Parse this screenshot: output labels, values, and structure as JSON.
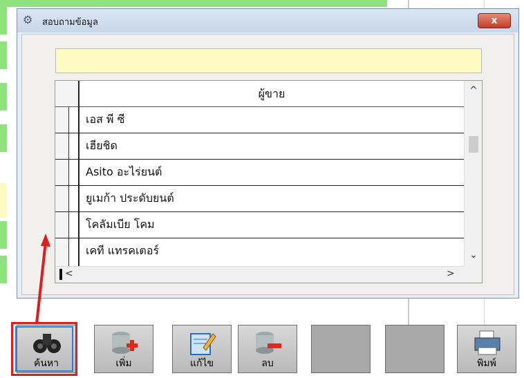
{
  "dialog": {
    "title": "สอบถามข้อมูล",
    "close_label": "x",
    "search_value": ""
  },
  "grid": {
    "column_header": "ผู้ขาย",
    "rows": [
      "เอส พี ซี",
      "เฮียชิด",
      "Asito อะไร่ยนต์",
      "ยูเมก้า ประดับยนต์",
      "โคลัมเบีย โคม",
      "เคที แทรคเตอร์"
    ]
  },
  "toolbar": {
    "search_label": "ค้นหา",
    "add_label": "เพิ่ม",
    "edit_label": "แก้ไข",
    "delete_label": "ลบ",
    "print_label": "พิมพ์"
  },
  "colors": {
    "search_field_bg": "#fdfac4",
    "annotation_red": "#e21c1c",
    "selection_blue": "#2f7fd6",
    "parent_green": "#8ee27d"
  },
  "icons": {
    "search": "binoculars-icon",
    "add": "database-add-icon",
    "edit": "notepad-edit-icon",
    "delete": "database-remove-icon",
    "print": "printer-icon"
  }
}
